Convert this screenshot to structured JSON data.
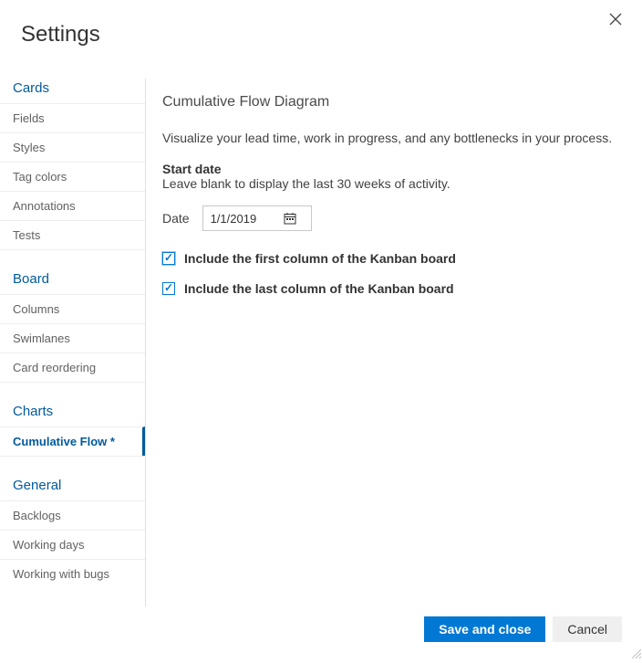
{
  "window": {
    "title": "Settings"
  },
  "sidebar": {
    "sections": {
      "cards": {
        "label": "Cards"
      },
      "board": {
        "label": "Board"
      },
      "charts": {
        "label": "Charts"
      },
      "general": {
        "label": "General"
      }
    },
    "items": {
      "fields": "Fields",
      "styles": "Styles",
      "tag_colors": "Tag colors",
      "annotations": "Annotations",
      "tests": "Tests",
      "columns": "Columns",
      "swimlanes": "Swimlanes",
      "card_reordering": "Card reordering",
      "cumulative_flow": "Cumulative Flow *",
      "backlogs": "Backlogs",
      "working_days": "Working days",
      "working_with_bugs": "Working with bugs"
    }
  },
  "panel": {
    "title": "Cumulative Flow Diagram",
    "description": "Visualize your lead time, work in progress, and any bottlenecks in your process.",
    "start_date_label": "Start date",
    "start_date_help": "Leave blank to display the last 30 weeks of activity.",
    "date_label": "Date",
    "date_value": "1/1/2019",
    "check_first_label": "Include the first column of the Kanban board",
    "check_first_checked": true,
    "check_last_label": "Include the last column of the Kanban board",
    "check_last_checked": true
  },
  "footer": {
    "save_label": "Save and close",
    "cancel_label": "Cancel"
  }
}
